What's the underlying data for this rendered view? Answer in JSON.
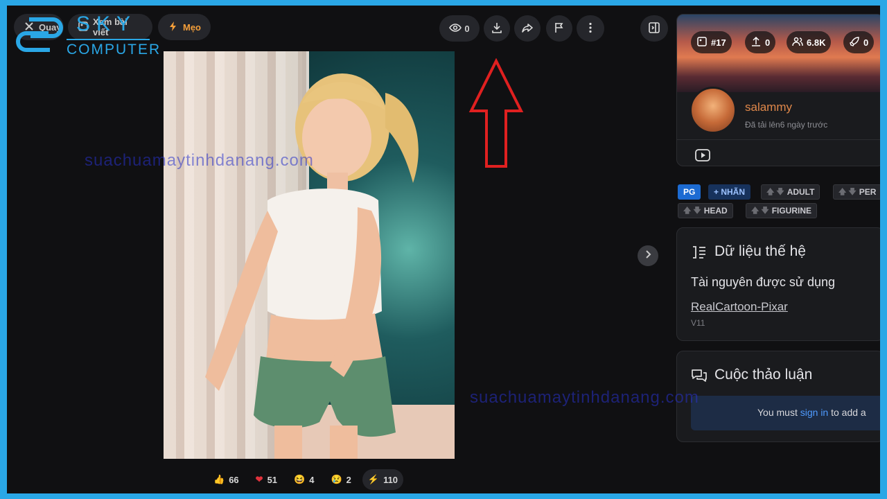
{
  "toolbar": {
    "back_label": "Quay",
    "view_post_label": "Xem bài viết",
    "tips_label": "Mẹo",
    "views_count": "0"
  },
  "logo": {
    "line1": "SKY",
    "line2": "COMPUTER"
  },
  "reactions": {
    "like": "66",
    "heart": "51",
    "laugh": "4",
    "cry": "2",
    "boost": "110"
  },
  "creator": {
    "rank": "#17",
    "uploads": "0",
    "followers": "6.8K",
    "boosts": "0",
    "username": "salammy",
    "uploaded_text": "Đã tải lên6 ngày trước"
  },
  "tags": {
    "rating": "PG",
    "add_label": "+ NHÃN",
    "items": [
      "ADULT",
      "PER",
      "HEAD",
      "FIGURINE"
    ]
  },
  "generation": {
    "title": "Dữ liệu thế hệ",
    "resources_label": "Tài nguyên được sử dụng",
    "resource_name": "RealCartoon-Pixar",
    "resource_version": "V11"
  },
  "discussion": {
    "title": "Cuộc thảo luận",
    "prefix": "You must",
    "link": "sign in",
    "suffix": "to add a"
  },
  "watermark": {
    "text1": "suachuamaytinhdanang.com",
    "text2": "suachuamaytinhdanang.com"
  },
  "colors": {
    "accent": "#2aa7e6",
    "arrow": "#e02020",
    "username": "#e0884a",
    "link": "#4f9bff"
  }
}
